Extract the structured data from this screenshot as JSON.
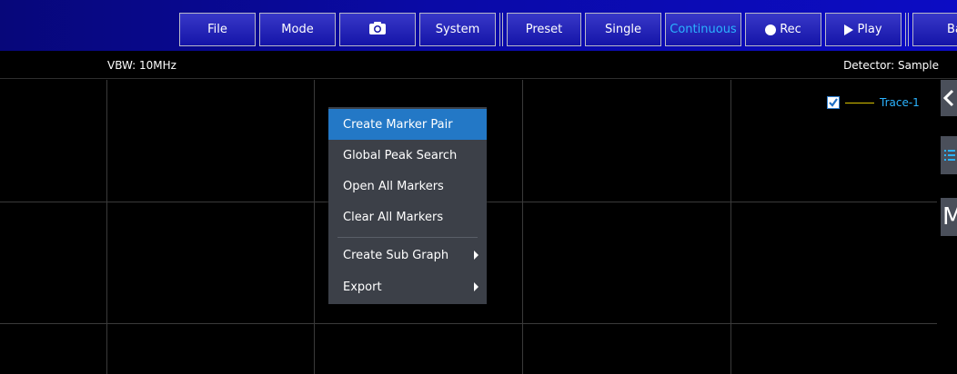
{
  "toolbar": {
    "file_label": "File",
    "mode_label": "Mode",
    "system_label": "System",
    "preset_label": "Preset",
    "single_label": "Single",
    "continuous_label": "Continuous",
    "rec_label": "Rec",
    "play_label": "Play",
    "basic_label": "Bas",
    "camera_icon": "camera-icon",
    "record_icon": "record-dot-icon",
    "play_icon": "play-triangle-icon",
    "active_color": "#2bb3ff"
  },
  "status": {
    "vbw": "VBW: 10MHz",
    "detector": "Detector: Sample"
  },
  "trace": {
    "label": "Trace-1",
    "checked": true,
    "line_color": "#d8c200"
  },
  "side_tabs": {
    "third_label": "M",
    "first_icon": "chevron-left-icon",
    "second_icon": "list-icon"
  },
  "context_menu": {
    "items": [
      {
        "label": "Create Marker Pair",
        "highlighted": true
      },
      {
        "label": "Global Peak Search"
      },
      {
        "label": "Open All Markers"
      },
      {
        "label": "Clear All Markers"
      },
      {
        "label": "Create Sub Graph",
        "submenu": true
      },
      {
        "label": "Export",
        "submenu": true
      }
    ]
  }
}
